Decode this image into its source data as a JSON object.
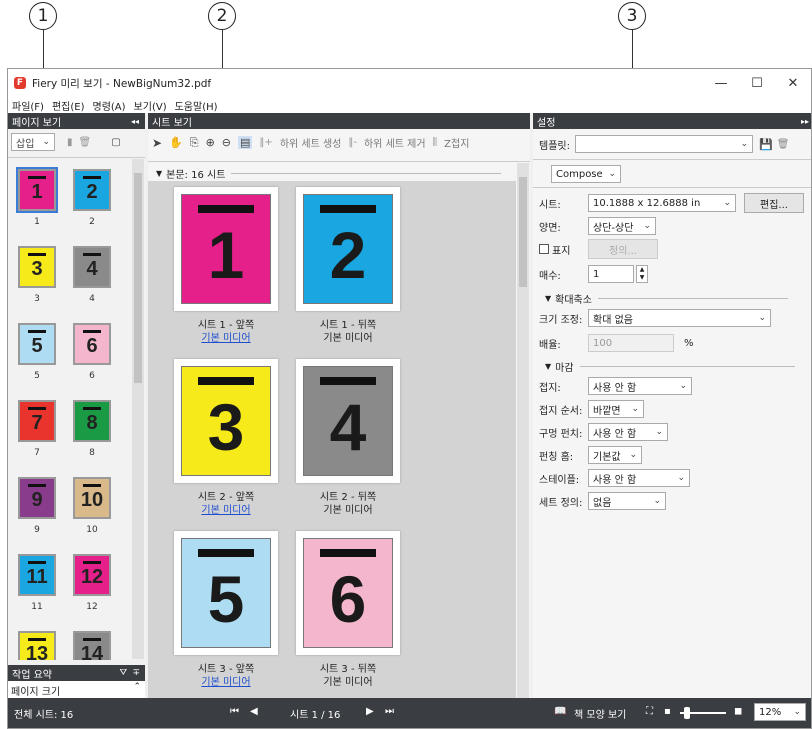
{
  "callouts": [
    "1",
    "2",
    "3"
  ],
  "window": {
    "title": "Fiery 미리 보기 - NewBigNum32.pdf",
    "app_icon_letter": "F",
    "minimize": "—",
    "maximize": "☐",
    "close": "✕"
  },
  "menu": [
    "파일(F)",
    "편집(E)",
    "명령(A)",
    "보기(V)",
    "도움말(H)"
  ],
  "page_view": {
    "header": "페이지 보기",
    "collapse": "◂◂",
    "insert_label": "삽입",
    "thumbs": [
      {
        "n": "1",
        "label": "1",
        "color": "#e6208a"
      },
      {
        "n": "2",
        "label": "2",
        "color": "#1aa6e0"
      },
      {
        "n": "3",
        "label": "3",
        "color": "#f6ea1a"
      },
      {
        "n": "4",
        "label": "4",
        "color": "#8a8a8a"
      },
      {
        "n": "5",
        "label": "5",
        "color": "#aedcf2"
      },
      {
        "n": "6",
        "label": "6",
        "color": "#f3b6cc"
      },
      {
        "n": "7",
        "label": "7",
        "color": "#e8342c"
      },
      {
        "n": "8",
        "label": "8",
        "color": "#1a9a44"
      },
      {
        "n": "9",
        "label": "9",
        "color": "#8a3c8c"
      },
      {
        "n": "10",
        "label": "10",
        "color": "#d9b98a"
      },
      {
        "n": "11",
        "label": "11",
        "color": "#1aa6e0"
      },
      {
        "n": "12",
        "label": "12",
        "color": "#e6208a"
      },
      {
        "n": "13",
        "label": "",
        "color": "#f6ea1a"
      },
      {
        "n": "14",
        "label": "",
        "color": "#8a8a8a"
      }
    ]
  },
  "job_summary": {
    "header": "작업 요약",
    "row": "페이지 크기"
  },
  "sheet_view": {
    "header": "시트 보기",
    "tools": {
      "create_subset": "하위 세트 생성",
      "remove_subset": "하위 세트 제거",
      "z_fold": "Z접지"
    },
    "section": "본문: 16 시트",
    "sheets": [
      {
        "n": "1",
        "color": "#e6208a",
        "line1": "시트 1 - 앞쪽",
        "line2": "기본 미디어",
        "link": true
      },
      {
        "n": "2",
        "color": "#1aa6e0",
        "line1": "시트 1 - 뒤쪽",
        "line2": "기본 미디어",
        "link": false
      },
      {
        "n": "3",
        "color": "#f6ea1a",
        "line1": "시트 2 - 앞쪽",
        "line2": "기본 미디어",
        "link": true
      },
      {
        "n": "4",
        "color": "#8a8a8a",
        "line1": "시트 2 - 뒤쪽",
        "line2": "기본 미디어",
        "link": false
      },
      {
        "n": "5",
        "color": "#aedcf2",
        "line1": "시트 3 - 앞쪽",
        "line2": "기본 미디어",
        "link": true
      },
      {
        "n": "6",
        "color": "#f3b6cc",
        "line1": "시트 3 - 뒤쪽",
        "line2": "기본 미디어",
        "link": false
      }
    ]
  },
  "settings": {
    "header": "설정",
    "collapse": "▸▸",
    "template_label": "템플릿:",
    "compose": "Compose",
    "sheet_label": "시트:",
    "sheet_value": "10.1888 x 12.6888 in",
    "edit_button": "편집...",
    "duplex_label": "양면:",
    "duplex_value": "상단-상단",
    "cover_label": "표지",
    "define_button": "정의...",
    "copies_label": "매수:",
    "copies_value": "1",
    "scale_section": "확대축소",
    "resize_label": "크기 조정:",
    "resize_value": "확대 없음",
    "ratio_label": "배율:",
    "ratio_value": "100",
    "ratio_unit": "%",
    "finish_section": "마감",
    "fold_label": "접지:",
    "fold_value": "사용 안 함",
    "fold_order_label": "접지 순서:",
    "fold_order_value": "바깥면",
    "punch_label": "구멍 펀치:",
    "punch_value": "사용 안 함",
    "punch_edge_label": "펀칭 홈:",
    "punch_edge_value": "기본값",
    "staple_label": "스테이플:",
    "staple_value": "사용 안 함",
    "set_def_label": "세트 정의:",
    "set_def_value": "없음"
  },
  "status": {
    "total_sheets": "전체 시트: 16",
    "page_indicator": "시트 1 / 16",
    "book_view": "책 모양 보기",
    "zoom": "12%"
  }
}
